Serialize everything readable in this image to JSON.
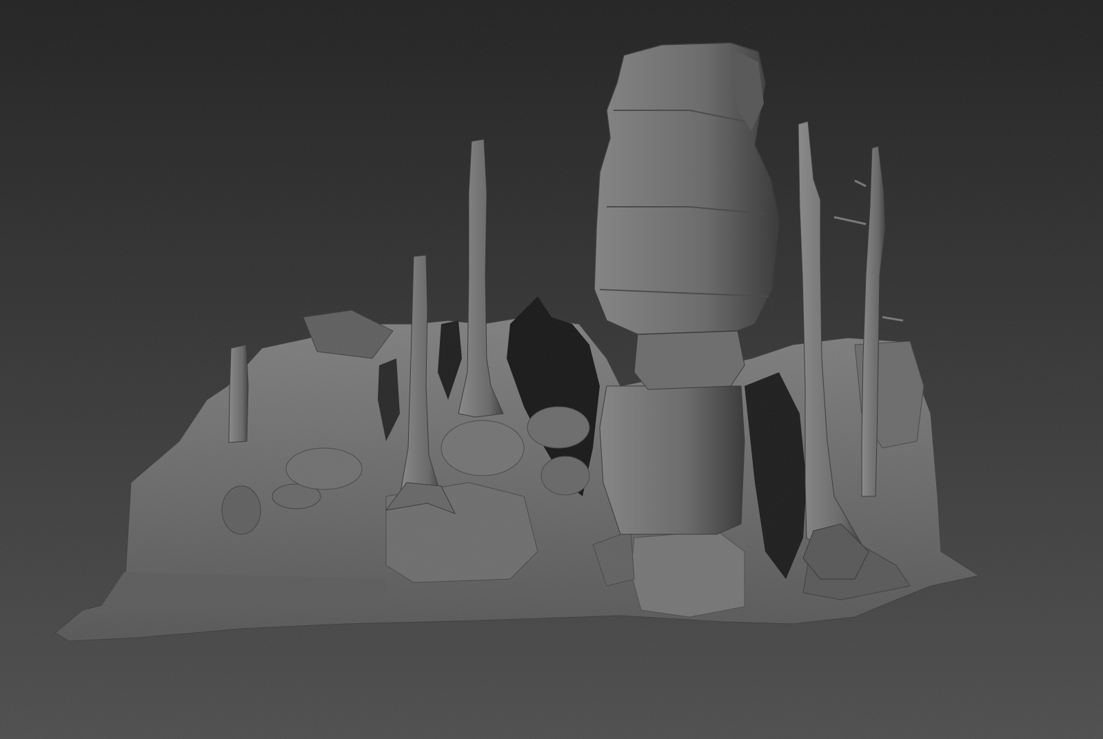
{
  "viewport": {
    "background_top_color": "#1e1e1e",
    "background_bottom_color": "#4b4b4b",
    "mesh_base_color": "#6a6a6a",
    "mesh_light_color": "#8c8c8c",
    "mesh_shadow_color": "#141414"
  },
  "scene": {
    "objects": [
      "terrain-mesh",
      "rock-pillar",
      "tree-trunk-1",
      "tree-trunk-2",
      "tree-trunk-3",
      "tree-trunk-4",
      "tree-trunk-5"
    ]
  }
}
